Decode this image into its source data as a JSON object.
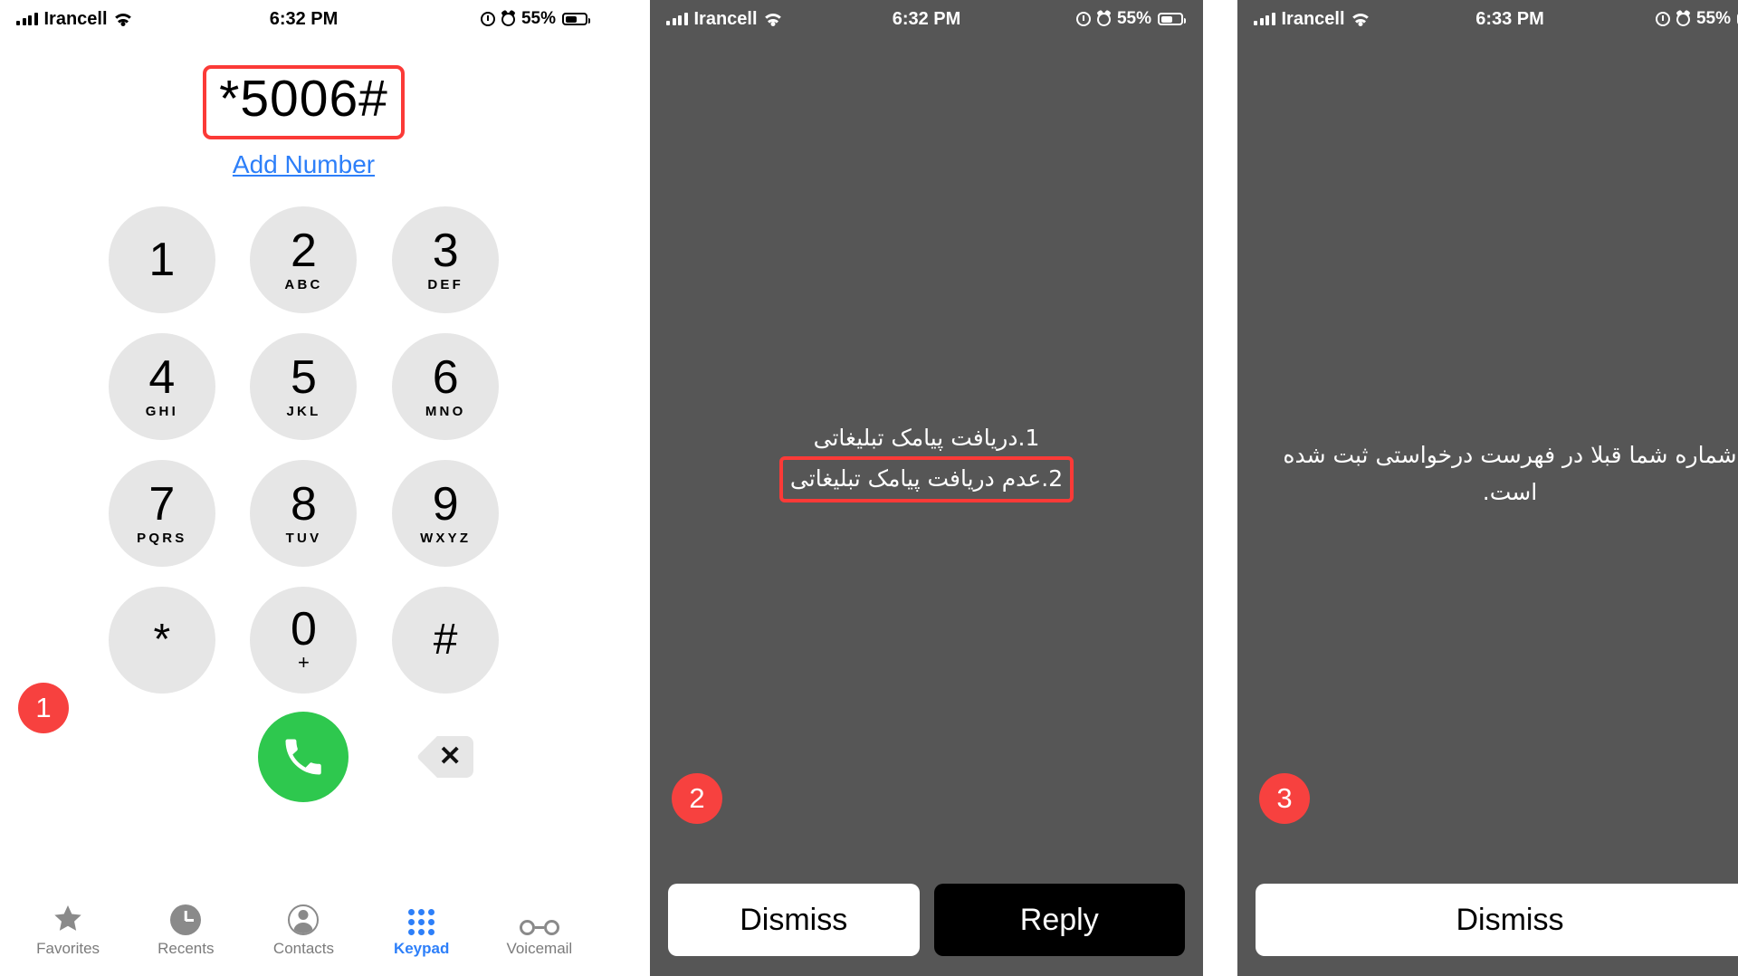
{
  "panels": [
    {
      "step_badge": "1",
      "status_bar": {
        "carrier": "Irancell",
        "time": "6:32 PM",
        "battery_percent": "55%",
        "icons": [
          "cellular-signal-icon",
          "wifi-icon",
          "rotation-lock-icon",
          "alarm-icon",
          "battery-icon"
        ]
      },
      "dialed_number": "*5006#",
      "add_number_label": "Add Number",
      "keypad": [
        {
          "digit": "1",
          "letters": ""
        },
        {
          "digit": "2",
          "letters": "ABC"
        },
        {
          "digit": "3",
          "letters": "DEF"
        },
        {
          "digit": "4",
          "letters": "GHI"
        },
        {
          "digit": "5",
          "letters": "JKL"
        },
        {
          "digit": "6",
          "letters": "MNO"
        },
        {
          "digit": "7",
          "letters": "PQRS"
        },
        {
          "digit": "8",
          "letters": "TUV"
        },
        {
          "digit": "9",
          "letters": "WXYZ"
        },
        {
          "digit": "*",
          "letters": ""
        },
        {
          "digit": "0",
          "letters": "+"
        },
        {
          "digit": "#",
          "letters": ""
        }
      ],
      "call_button": "call-icon",
      "backspace_button": "backspace-icon",
      "tabs": [
        {
          "label": "Favorites",
          "icon": "star-icon",
          "active": false
        },
        {
          "label": "Recents",
          "icon": "clock-icon",
          "active": false
        },
        {
          "label": "Contacts",
          "icon": "person-circle-icon",
          "active": false
        },
        {
          "label": "Keypad",
          "icon": "keypad-dots-icon",
          "active": true
        },
        {
          "label": "Voicemail",
          "icon": "voicemail-icon",
          "active": false
        }
      ]
    },
    {
      "step_badge": "2",
      "status_bar": {
        "carrier": "Irancell",
        "time": "6:32 PM",
        "battery_percent": "55%"
      },
      "message_lines": [
        {
          "text": "1.دریافت پیامک تبلیغاتی",
          "highlighted": false
        },
        {
          "text": "2.عدم دریافت پیامک تبلیغاتی",
          "highlighted": true
        }
      ],
      "buttons": [
        {
          "label": "Dismiss",
          "style": "light"
        },
        {
          "label": "Reply",
          "style": "dark"
        }
      ]
    },
    {
      "step_badge": "3",
      "status_bar": {
        "carrier": "Irancell",
        "time": "6:33 PM",
        "battery_percent": "55%"
      },
      "message_lines": [
        {
          "text": "شماره شما قبلا در فهرست درخواستی ثبت شده است.",
          "highlighted": false
        }
      ],
      "buttons": [
        {
          "label": "Dismiss",
          "style": "light"
        }
      ]
    }
  ],
  "colors": {
    "accent_blue": "#2d7ff9",
    "call_green": "#2ec84e",
    "badge_red": "#f7413f",
    "highlight_red": "#fb3a37",
    "ussd_gray": "#565656",
    "key_gray": "#e6e6e6"
  }
}
